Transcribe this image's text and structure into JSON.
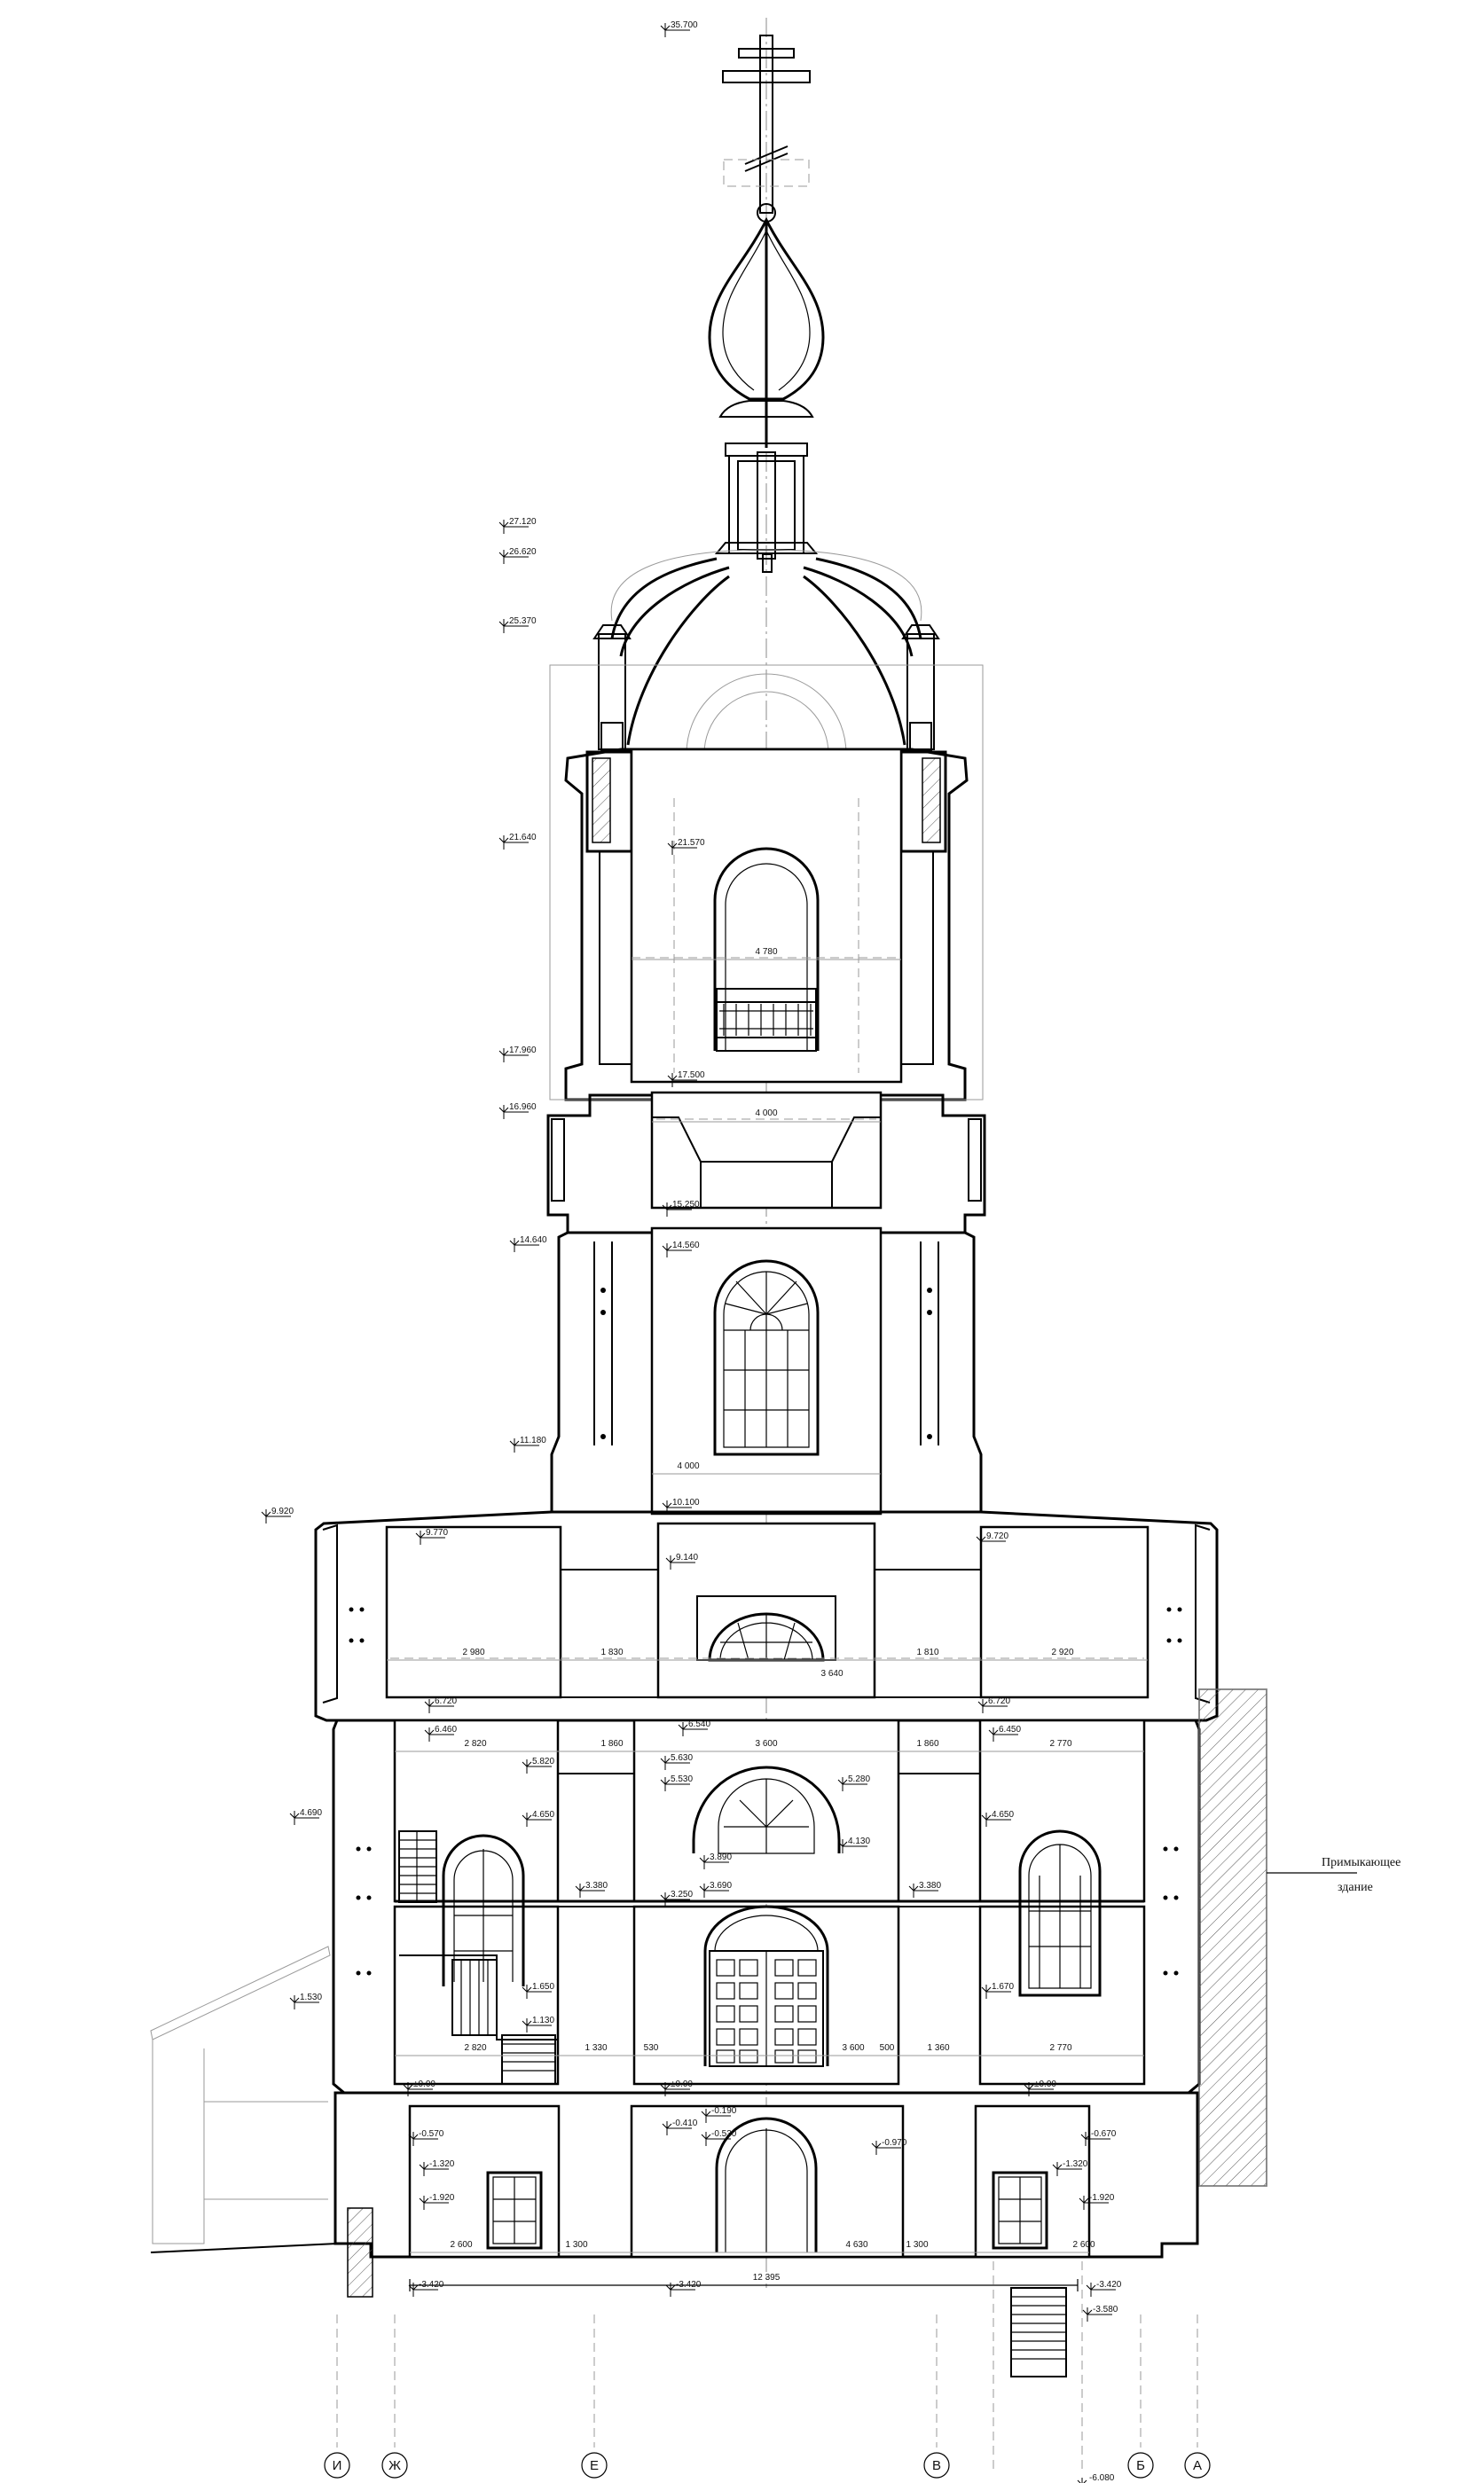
{
  "levels": {
    "top_cross": "35.700",
    "l27120": "27.120",
    "l26620": "26.620",
    "l25370": "25.370",
    "l21640": "21.640",
    "l21570": "21.570",
    "l17960": "17.960",
    "l17500": "17.500",
    "l16960": "16.960",
    "l15250": "15.250",
    "l14640": "14.640",
    "l14560": "14.560",
    "l11180": "11.180",
    "l10100": "10.100",
    "l9920": "9.920",
    "l9770": "9.770",
    "l9140": "9.140",
    "l9720": "9.720",
    "l6720a": "6.720",
    "l6720b": "6.720",
    "l6540": "6.540",
    "l6460": "6.460",
    "l6450": "6.450",
    "l5820": "5.820",
    "l5630": "5.630",
    "l5530": "5.530",
    "l5280": "5.280",
    "l4690": "4.690",
    "l4650a": "4.650",
    "l4650b": "4.650",
    "l4130": "4.130",
    "l3890": "3.890",
    "l3380a": "3.380",
    "l3380b": "3.380",
    "l3250": "3.250",
    "l3690": "3.690",
    "l1650": "1.650",
    "l1670": "1.670",
    "l1530": "1.530",
    "l1130": "1.130",
    "zero_a": "±0.00",
    "zero_b": "±0.00",
    "zero_c": "±0.00",
    "m0190": "-0.190",
    "m0410": "-0.410",
    "m0530": "-0.530",
    "m0570": "-0.570",
    "m0670": "-0.670",
    "m0970": "-0.970",
    "m1320a": "-1.320",
    "m1320b": "-1.320",
    "m1920a": "-1.920",
    "m1920b": "-1.920",
    "m3420a": "-3.420",
    "m3420b": "-3.420",
    "m3420c": "-3.420",
    "m3580": "-3.580",
    "m6080": "-6.080"
  },
  "dimensions": {
    "bell_width": "4 780",
    "tower_width_a": "4 000",
    "tower_width_b": "4 000",
    "u_2980": "2 980",
    "u_1830": "1 830",
    "u_3640": "3 640",
    "u_1810": "1 810",
    "u_2920": "2 920",
    "m_2820": "2 820",
    "m_1860a": "1 860",
    "m_3600": "3 600",
    "m_1860b": "1 860",
    "m_2770": "2 770",
    "g_2820": "2 820",
    "g_1330": "1 330",
    "g_530": "530",
    "g_3600": "3 600",
    "g_500": "500",
    "g_1360": "1 360",
    "g_2770": "2 770",
    "b_2600a": "2 600",
    "b_1300a": "1 300",
    "b_4630": "4 630",
    "b_1300b": "1 300",
    "b_2600b": "2 600",
    "overall": "12 395"
  },
  "annotation": {
    "line1": "Примыкающее",
    "line2": "здание"
  },
  "axes": [
    "И",
    "Ж",
    "Е",
    "В",
    "Б",
    "А"
  ]
}
